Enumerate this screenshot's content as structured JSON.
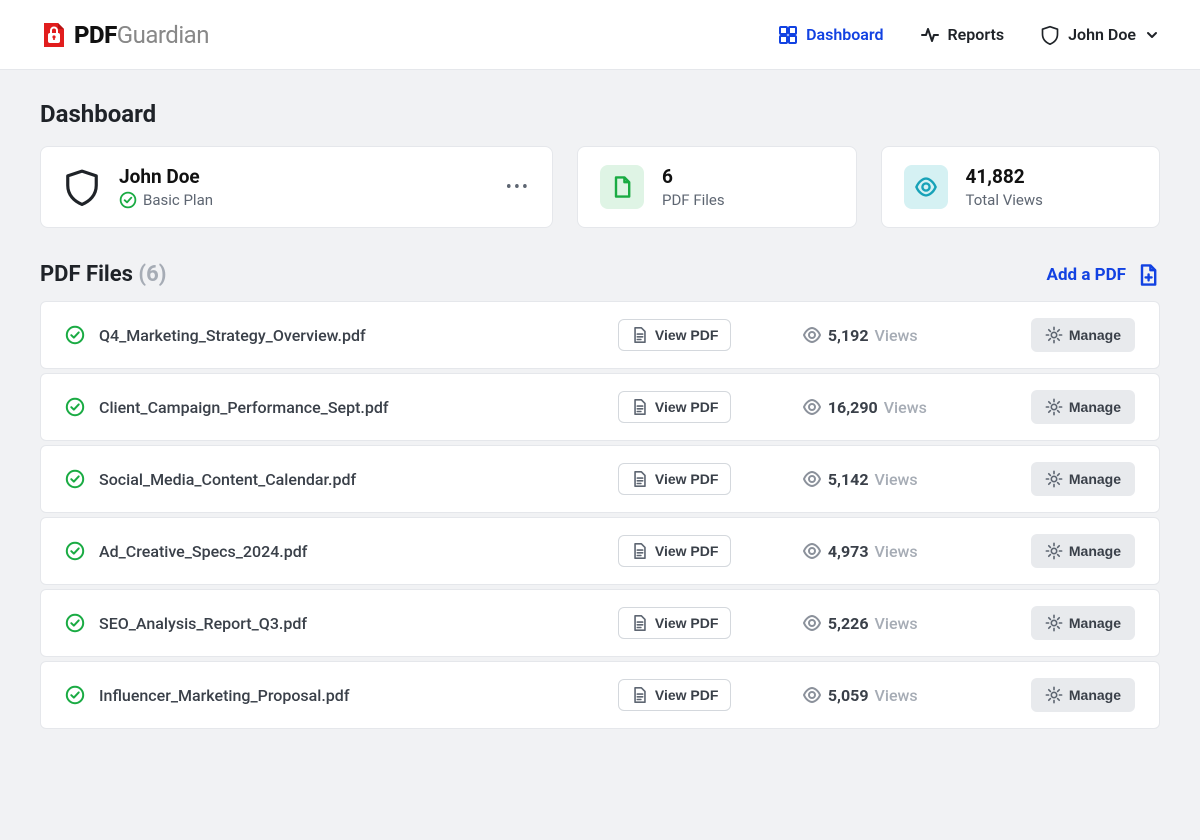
{
  "brand": {
    "strong": "PDF",
    "light": "Guardian"
  },
  "nav": {
    "dashboard": "Dashboard",
    "reports": "Reports",
    "user_name": "John Doe"
  },
  "page": {
    "title": "Dashboard"
  },
  "userCard": {
    "name": "John Doe",
    "plan": "Basic Plan"
  },
  "stats": {
    "files": {
      "value": "6",
      "label": "PDF Files"
    },
    "views": {
      "value": "41,882",
      "label": "Total Views"
    }
  },
  "section": {
    "title": "PDF Files",
    "count": "(6)",
    "add_label": "Add a PDF"
  },
  "labels": {
    "view_pdf": "View PDF",
    "manage": "Manage",
    "views": "Views"
  },
  "files": [
    {
      "name": "Q4_Marketing_Strategy_Overview.pdf",
      "views": "5,192"
    },
    {
      "name": "Client_Campaign_Performance_Sept.pdf",
      "views": "16,290"
    },
    {
      "name": "Social_Media_Content_Calendar.pdf",
      "views": "5,142"
    },
    {
      "name": "Ad_Creative_Specs_2024.pdf",
      "views": "4,973"
    },
    {
      "name": "SEO_Analysis_Report_Q3.pdf",
      "views": "5,226"
    },
    {
      "name": "Influencer_Marketing_Proposal.pdf",
      "views": "5,059"
    }
  ],
  "colors": {
    "primary": "#1242e2",
    "green": "#1aab43",
    "red": "#e11d1d"
  }
}
